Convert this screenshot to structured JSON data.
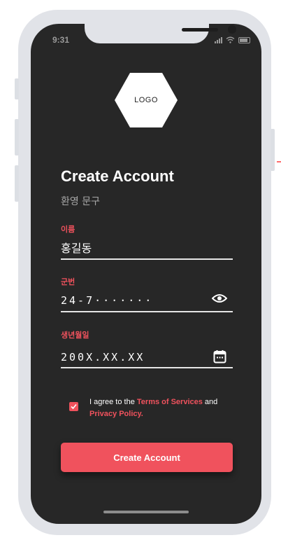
{
  "status_bar": {
    "time": "9:31"
  },
  "logo": {
    "text": "LOGO"
  },
  "header": {
    "title": "Create Account",
    "subtitle": "환영 문구"
  },
  "fields": {
    "name": {
      "label": "이름",
      "value": "홍길동"
    },
    "rrn": {
      "label": "군번",
      "value": "24-7·······"
    },
    "birthdate": {
      "label": "생년월일",
      "value": "200X.XX.XX"
    }
  },
  "agreement": {
    "checked": true,
    "prefix": "I agree to the ",
    "terms_link": "Terms of Services",
    "middle": " and",
    "privacy_link": "Privacy Policy."
  },
  "cta": {
    "label": "Create Account"
  },
  "colors": {
    "accent": "#f0525d",
    "background": "#272727",
    "frame": "#e1e3e8"
  },
  "icons": {
    "password_toggle": "eye-icon",
    "date_picker": "calendar-icon",
    "check": "check-icon"
  }
}
